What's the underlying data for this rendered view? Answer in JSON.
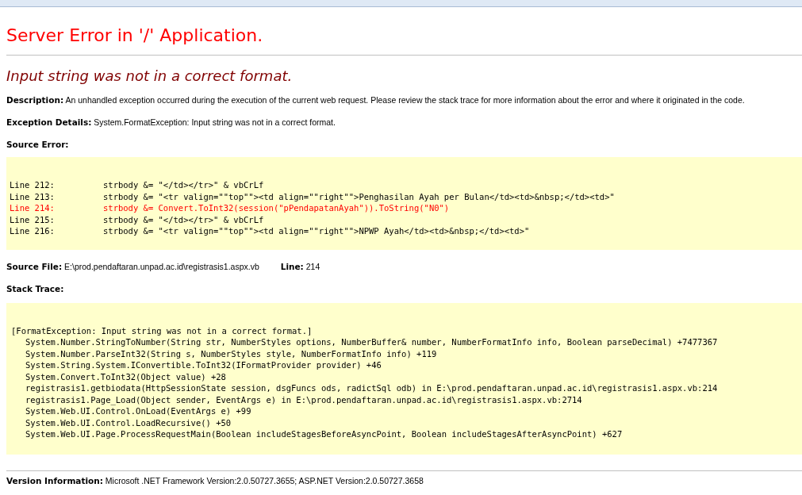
{
  "title": "Server Error in '/' Application.",
  "message": "Input string was not in a correct format.",
  "description": {
    "label": "Description:",
    "text": "An unhandled exception occurred during the execution of the current web request. Please review the stack trace for more information about the error and where it originated in the code."
  },
  "exception_details": {
    "label": "Exception Details:",
    "text": "System.FormatException: Input string was not in a correct format."
  },
  "source_error": {
    "label": "Source Error:",
    "lines": [
      {
        "line": "Line 212:",
        "code": "strbody &= \"</td></tr>\" & vbCrLf",
        "highlighted": false
      },
      {
        "line": "Line 213:",
        "code": "strbody &= \"<tr valign=\"\"top\"\"><td align=\"\"right\"\">Penghasilan Ayah per Bulan</td><td>&nbsp;</td><td>\"",
        "highlighted": false
      },
      {
        "line": "Line 214:",
        "code": "strbody &= Convert.ToInt32(session(\"pPendapatanAyah\")).ToString(\"N0\")",
        "highlighted": true
      },
      {
        "line": "Line 215:",
        "code": "strbody &= \"</td></tr>\" & vbCrLf",
        "highlighted": false
      },
      {
        "line": "Line 216:",
        "code": "strbody &= \"<tr valign=\"\"top\"\"><td align=\"\"right\"\">NPWP Ayah</td><td>&nbsp;</td><td>\"",
        "highlighted": false
      }
    ]
  },
  "source_file": {
    "label": "Source File:",
    "value": "E:\\prod.pendaftaran.unpad.ac.id\\registrasis1.aspx.vb",
    "line_label": "Line:",
    "line_value": "214"
  },
  "stack_trace": {
    "label": "Stack Trace:",
    "exception": "[FormatException: Input string was not in a correct format.]",
    "frames": [
      "System.Number.StringToNumber(String str, NumberStyles options, NumberBuffer& number, NumberFormatInfo info, Boolean parseDecimal) +7477367",
      "System.Number.ParseInt32(String s, NumberStyles style, NumberFormatInfo info) +119",
      "System.String.System.IConvertible.ToInt32(IFormatProvider provider) +46",
      "System.Convert.ToInt32(Object value) +28",
      "registrasis1.getbiodata(HttpSessionState session, dsgFuncs ods, radictSql odb) in E:\\prod.pendaftaran.unpad.ac.id\\registrasis1.aspx.vb:214",
      "registrasis1.Page_Load(Object sender, EventArgs e) in E:\\prod.pendaftaran.unpad.ac.id\\registrasis1.aspx.vb:2714",
      "System.Web.UI.Control.OnLoad(EventArgs e) +99",
      "System.Web.UI.Control.LoadRecursive() +50",
      "System.Web.UI.Page.ProcessRequestMain(Boolean includeStagesBeforeAsyncPoint, Boolean includeStagesAfterAsyncPoint) +627"
    ]
  },
  "version": {
    "label": "Version Information:",
    "text": "Microsoft .NET Framework Version:2.0.50727.3655; ASP.NET Version:2.0.50727.3658"
  }
}
